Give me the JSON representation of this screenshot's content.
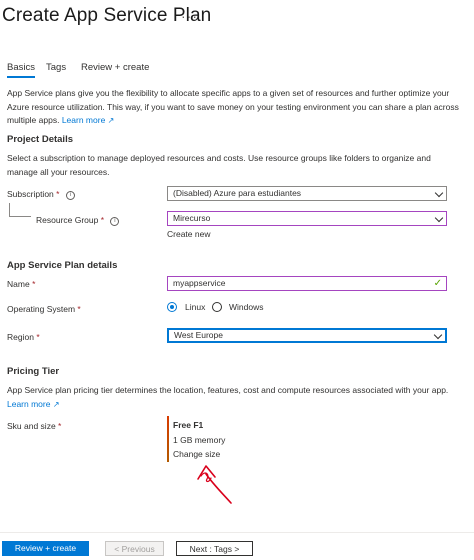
{
  "header": {
    "title": "Create App Service Plan",
    "more": "···"
  },
  "tabs": [
    {
      "label": "Basics"
    },
    {
      "label": "Tags"
    },
    {
      "label": "Review + create"
    }
  ],
  "intro": {
    "text": "App Service plans give you the flexibility to allocate specific apps to a given set of resources and further optimize your Azure resource utilization. This way, if you want to save money on your testing environment you can share a plan across multiple apps.",
    "learn_more": "Learn more"
  },
  "project": {
    "title": "Project Details",
    "description": "Select a subscription to manage deployed resources and costs. Use resource groups like folders to organize and manage all your resources.",
    "subscription_label": "Subscription",
    "subscription_value": "(Disabled) Azure para estudiantes",
    "resource_group_label": "Resource Group",
    "resource_group_value": "Mirecurso",
    "create_new": "Create new"
  },
  "plan": {
    "title": "App Service Plan details",
    "name_label": "Name",
    "name_value": "myappservice",
    "os_label": "Operating System",
    "os_options": [
      "Linux",
      "Windows"
    ],
    "os_selected": "Linux",
    "region_label": "Region",
    "region_value": "West Europe"
  },
  "pricing": {
    "title": "Pricing Tier",
    "description": "App Service plan pricing tier determines the location, features, cost and compute resources associated with your app.",
    "learn_more": "Learn more",
    "sku_label": "Sku and size",
    "sku_name": "Free F1",
    "sku_memory": "1 GB memory",
    "change_size": "Change size"
  },
  "required_mark": "*",
  "footer": {
    "review_create": "Review + create",
    "previous": "< Previous",
    "next": "Next : Tags >"
  },
  "colors": {
    "accent": "#0078d4",
    "required": "#a4262c",
    "annotation": "#d9001b"
  }
}
